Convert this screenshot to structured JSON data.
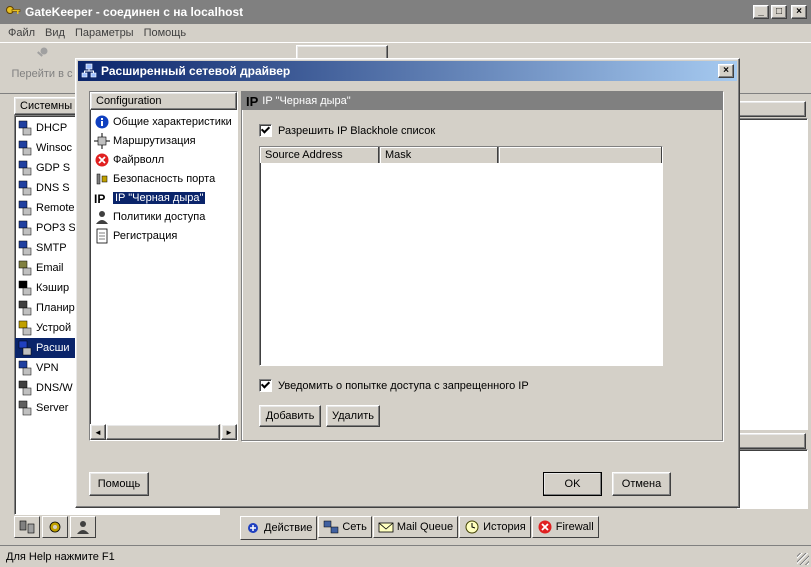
{
  "app": {
    "title": "GateKeeper - соединен с на localhost",
    "menu": [
      "Файл",
      "Вид",
      "Параметры",
      "Помощь"
    ],
    "toolbar_partial_label": "Перейти в с",
    "status": "Для Help нажмите F1",
    "caption_buttons": [
      "_",
      "□",
      "×"
    ]
  },
  "left_panel": {
    "header": "Системны",
    "items": [
      "DHCP",
      "Winsoc",
      "GDP S",
      "DNS S",
      "Remote",
      "POP3 S",
      "SMTP",
      "Email",
      "Кэшир",
      "Планир",
      "Устрой",
      "Расши",
      "VPN",
      "DNS/W",
      "Server"
    ],
    "selected_index": 11
  },
  "bottom_tabs": [
    "Действие",
    "Сеть",
    "Mail Queue",
    "История",
    "Firewall"
  ],
  "dialog": {
    "title": "Расширенный сетевой драйвер",
    "close_label": "×",
    "tree_header": "Configuration",
    "tree_items": [
      "Общие характеристики",
      "Маршрутизация",
      "Файрволл",
      "Безопасность порта",
      "IP \"Черная дыра\"",
      "Политики доступа",
      "Регистрация"
    ],
    "tree_selected_index": 4,
    "panel_prefix": "IP",
    "panel_title": "IP \"Черная дыра\"",
    "enable_label": "Разрешить IP Blackhole список",
    "columns": [
      "Source Address",
      "Mask"
    ],
    "notify_label": "Уведомить о попытке доступа с запрещенного IP",
    "add_button": "Добавить",
    "remove_button": "Удалить",
    "help_button": "Помощь",
    "ok_button": "OK",
    "cancel_button": "Отмена",
    "scroll_left": "◄",
    "scroll_right": "►"
  }
}
